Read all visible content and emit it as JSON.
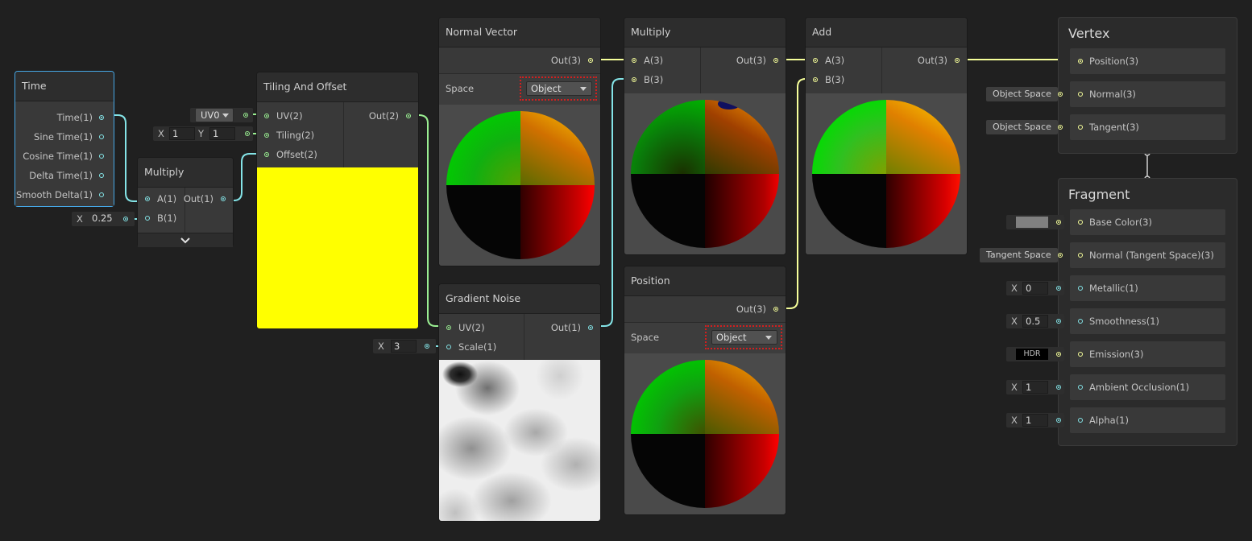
{
  "nodes": {
    "time": {
      "title": "Time",
      "outputs": [
        "Time(1)",
        "Sine Time(1)",
        "Cosine Time(1)",
        "Delta Time(1)",
        "Smooth Delta(1)"
      ]
    },
    "multiply_small": {
      "title": "Multiply",
      "input_a": "A(1)",
      "input_b": "B(1)",
      "output": "Out(1)",
      "b_axis": "X",
      "b_value": "0.25",
      "expand_icon": "chevron-down-icon"
    },
    "tiling": {
      "title": "Tiling And Offset",
      "inputs": [
        "UV(2)",
        "Tiling(2)",
        "Offset(2)"
      ],
      "output": "Out(2)",
      "uv_channel": "UV0",
      "tiling_x_label": "X",
      "tiling_x": "1",
      "tiling_y_label": "Y",
      "tiling_y": "1",
      "preview_color": "#ffff00"
    },
    "normal_vector": {
      "title": "Normal Vector",
      "output": "Out(3)",
      "space_label": "Space",
      "space_value": "Object"
    },
    "gradient_noise": {
      "title": "Gradient Noise",
      "inputs": [
        "UV(2)",
        "Scale(1)"
      ],
      "output": "Out(1)",
      "scale_axis": "X",
      "scale_value": "3"
    },
    "multiply_big": {
      "title": "Multiply",
      "input_a": "A(3)",
      "input_b": "B(3)",
      "output": "Out(3)"
    },
    "position": {
      "title": "Position",
      "output": "Out(3)",
      "space_label": "Space",
      "space_value": "Object"
    },
    "add": {
      "title": "Add",
      "input_a": "A(3)",
      "input_b": "B(3)",
      "output": "Out(3)"
    }
  },
  "vertex": {
    "title": "Vertex",
    "slots": [
      "Position(3)",
      "Normal(3)",
      "Tangent(3)"
    ],
    "normal_default": "Object Space",
    "tangent_default": "Object Space"
  },
  "fragment": {
    "title": "Fragment",
    "slots": [
      "Base Color(3)",
      "Normal (Tangent Space)(3)",
      "Metallic(1)",
      "Smoothness(1)",
      "Emission(3)",
      "Ambient Occlusion(1)",
      "Alpha(1)"
    ],
    "normal_default": "Tangent Space",
    "metallic_axis": "X",
    "metallic": "0",
    "smoothness_axis": "X",
    "smoothness": "0.5",
    "emission": "HDR",
    "ao_axis": "X",
    "ao": "1",
    "alpha_axis": "X",
    "alpha": "1",
    "base_color": "#808080"
  },
  "colors": {
    "float_port": "#84e4e7",
    "vec2_port": "#9aef92",
    "vec3_port": "#f6ff9a",
    "selection": "#46a7e6",
    "highlight_box": "#d21f1f"
  }
}
